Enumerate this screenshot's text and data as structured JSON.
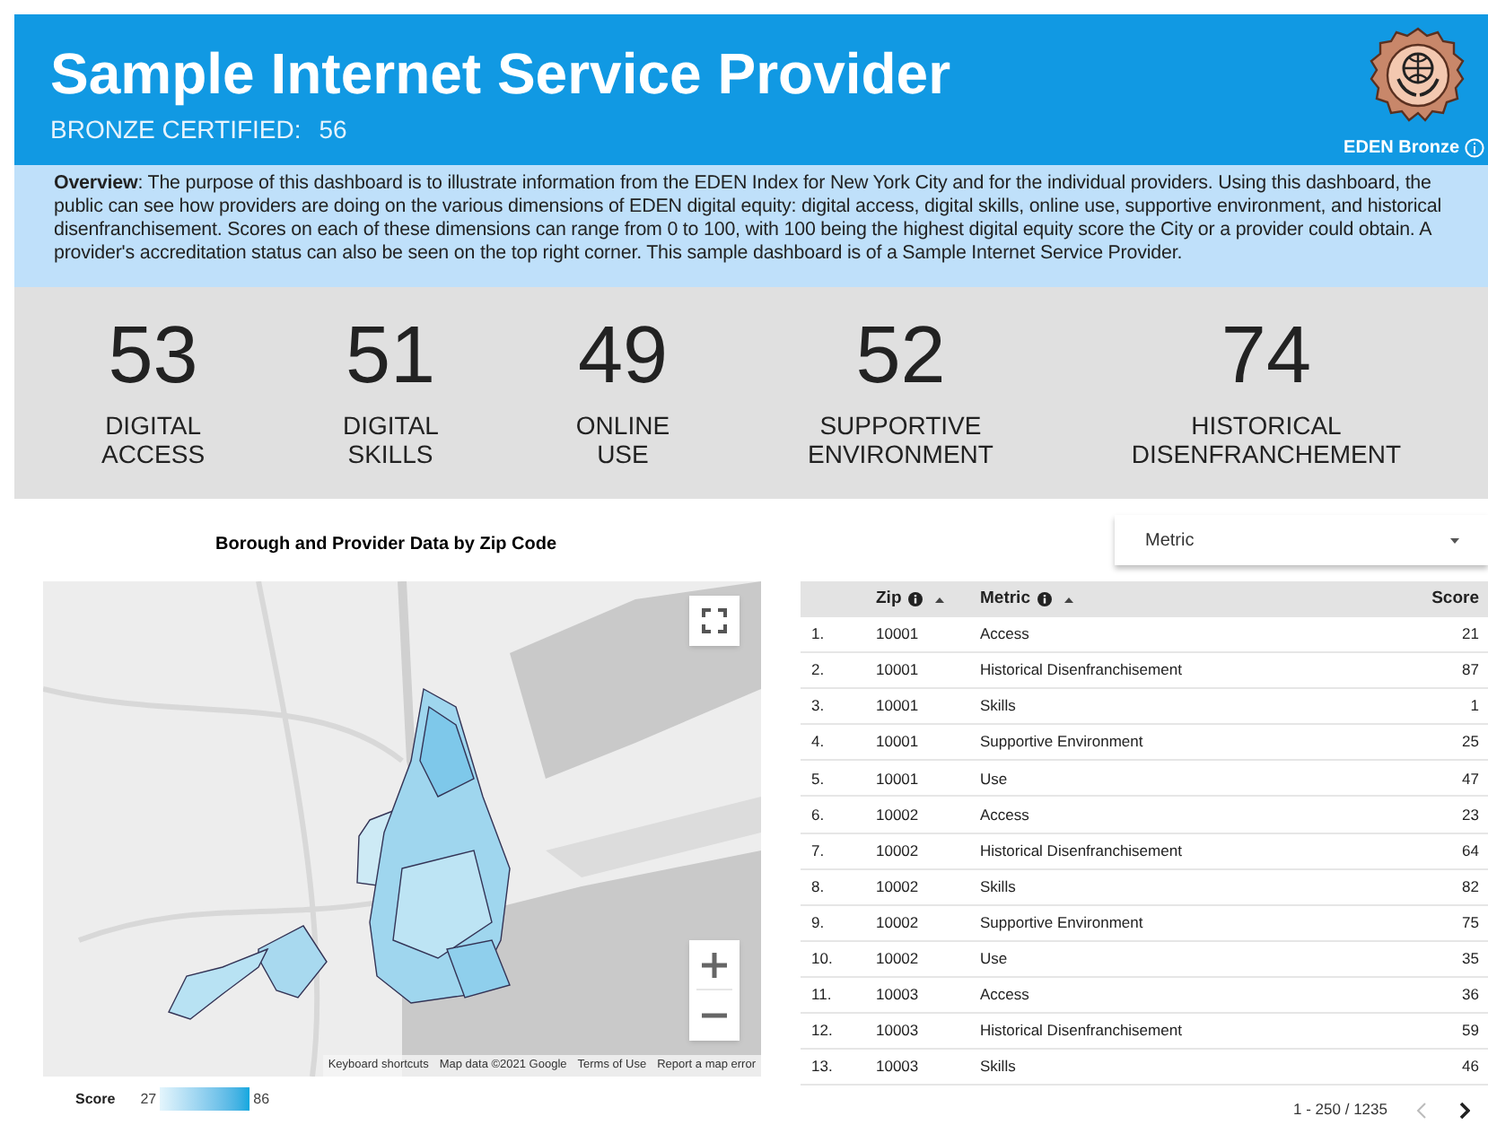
{
  "header": {
    "title": "Sample Internet Service Provider",
    "certification_label": "BRONZE CERTIFIED:",
    "certification_score": "56",
    "badge_label": "EDEN Bronze"
  },
  "overview": "**Overview**: The purpose of this dashboard is to illustrate information from the EDEN Index for New York City and for the individual providers. Using this dashboard, the public can see how providers are doing on the various dimensions of EDEN digital equity: digital access, digital skills, online use, supportive environment, and historical disenfranchisement. Scores on each of these dimensions can range from 0 to 100, with 100 being the highest digital equity score the City or a provider could obtain. A provider's accreditation status can also be seen on the top right corner. This sample dashboard is of a Sample Internet Service Provider.",
  "stats": [
    {
      "value": "53",
      "label": "DIGITAL ACCESS"
    },
    {
      "value": "51",
      "label": "DIGITAL SKILLS"
    },
    {
      "value": "49",
      "label": "ONLINE USE"
    },
    {
      "value": "52",
      "label": "SUPPORTIVE ENVIRONMENT"
    },
    {
      "value": "74",
      "label": "HISTORICAL DISENFRANCHEMENT"
    }
  ],
  "map": {
    "title": "Borough and Provider Data by Zip Code",
    "attribution": [
      "Keyboard shortcuts",
      "Map data ©2021 Google",
      "Terms of Use",
      "Report a map error"
    ],
    "legend": {
      "label": "Score",
      "min": "27",
      "max": "86"
    }
  },
  "filter": {
    "placeholder": "Metric"
  },
  "table": {
    "columns": [
      {
        "kind": "index"
      },
      {
        "label": "Zip",
        "kind": "sortable"
      },
      {
        "label": "Metric",
        "kind": "sortable"
      },
      {
        "label": "Score",
        "kind": "number"
      }
    ],
    "rows": [
      [
        "1.",
        "10001",
        "Access",
        "21"
      ],
      [
        "2.",
        "10001",
        "Historical Disenfranchisement",
        "87"
      ],
      [
        "3.",
        "10001",
        "Skills",
        "1"
      ],
      [
        "4.",
        "10001",
        "Supportive Environment",
        "25"
      ],
      [
        "5.",
        "10001",
        "Use",
        "47"
      ],
      [
        "6.",
        "10002",
        "Access",
        "23"
      ],
      [
        "7.",
        "10002",
        "Historical Disenfranchisement",
        "64"
      ],
      [
        "8.",
        "10002",
        "Skills",
        "82"
      ],
      [
        "9.",
        "10002",
        "Supportive Environment",
        "75"
      ],
      [
        "10.",
        "10002",
        "Use",
        "35"
      ],
      [
        "11.",
        "10003",
        "Access",
        "36"
      ],
      [
        "12.",
        "10003",
        "Historical Disenfranchisement",
        "59"
      ],
      [
        "13.",
        "10003",
        "Skills",
        "46"
      ]
    ],
    "pagination": {
      "range": "1 - 250 / 1235",
      "previous_disabled": true,
      "next_disabled": false
    }
  }
}
